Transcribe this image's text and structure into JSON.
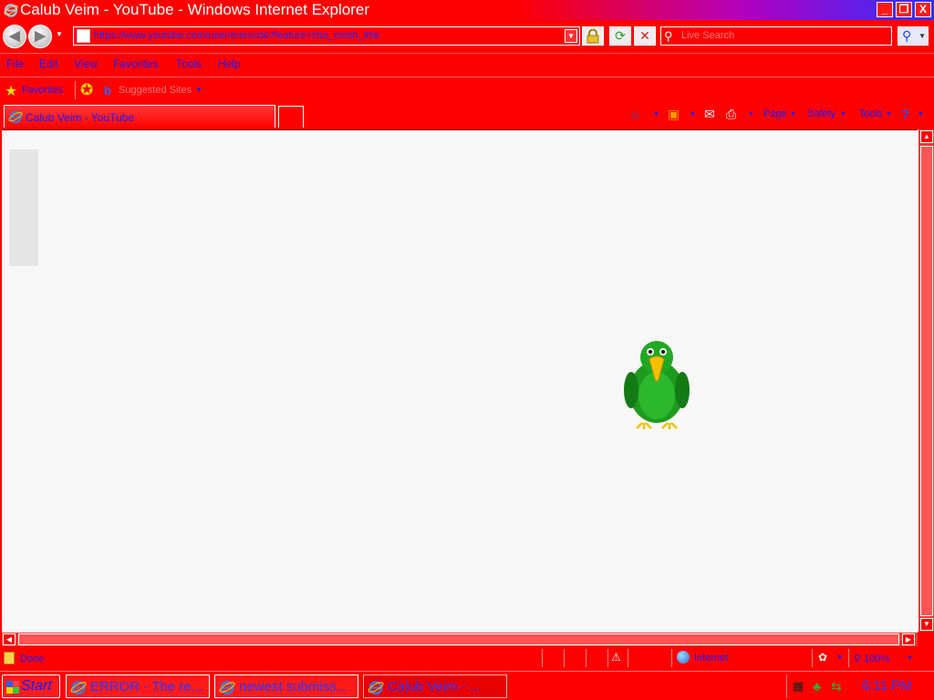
{
  "window": {
    "title": "Calub Veim - YouTube - Windows Internet Explorer",
    "minimize": "_",
    "maximize": "❐",
    "close": "X"
  },
  "nav": {
    "address": "https://www.youtube.com/user/emrvcdo?feature=cha_mosh_title",
    "back_glyph": "◀",
    "forward_glyph": "▶",
    "search_placeholder": "Live Search"
  },
  "menu": {
    "items": [
      "File",
      "Edit",
      "View",
      "Favorites",
      "Tools",
      "Help"
    ]
  },
  "favorites": {
    "label": "Favorites",
    "web_slice": "Suggested Sites"
  },
  "tab": {
    "label": "Calub Veim - YouTube"
  },
  "commands": {
    "page": "Page",
    "safety": "Safety",
    "tools": "Tools"
  },
  "status": {
    "text": "Done",
    "zone": "Internet",
    "zoom": "100%"
  },
  "taskbar": {
    "start": "Start",
    "items": [
      {
        "label": "ERROR - The re..."
      },
      {
        "label": "newest submiss..."
      },
      {
        "label": "Calub Veim - ..."
      }
    ],
    "clock": "6:11 PM"
  },
  "colors": {
    "chrome": "#ff0000",
    "text": "#1a1aff",
    "content_bg": "#f8f8f8",
    "parrot": "#1e9a1e"
  }
}
